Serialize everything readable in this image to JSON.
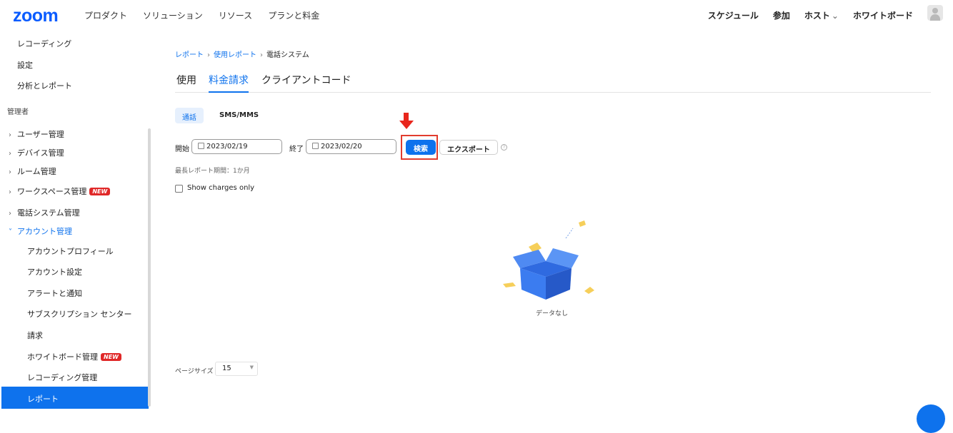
{
  "app": {
    "logo": "zoom"
  },
  "topnav": {
    "left": [
      "プロダクト",
      "ソリューション",
      "リソース",
      "プランと料金"
    ],
    "right": [
      "スケジュール",
      "参加",
      "ホスト",
      "ホワイトボード"
    ],
    "host_chevron": "⌄"
  },
  "sidebar": {
    "top_items": [
      "レコーディング",
      "設定",
      "分析とレポート"
    ],
    "admin_heading": "管理者",
    "admin_items": [
      "ユーザー管理",
      "デバイス管理",
      "ルーム管理",
      "ワークスペース管理",
      "電話システム管理",
      "アカウント管理"
    ],
    "new_badge": "NEW",
    "account_sub": [
      "アカウントプロフィール",
      "アカウント設定",
      "アラートと通知",
      "サブスクリプション センター",
      "請求",
      "ホワイトボード管理",
      "レコーディング管理",
      "レポート"
    ],
    "chevron_right": "›",
    "chevron_down": "˅"
  },
  "breadcrumb": {
    "items": [
      "レポート",
      "使用レポート",
      "電話システム"
    ],
    "sep": "›"
  },
  "tabs": [
    "使用",
    "料金請求",
    "クライアントコード"
  ],
  "subtabs": [
    "通話",
    "SMS/MMS"
  ],
  "filters": {
    "start_label": "開始",
    "start_date": "2023/02/19",
    "end_label": "終了",
    "end_date": "2023/02/20",
    "search_button": "検索",
    "export_button": "エクスポート",
    "help": "?",
    "max_period": "最長レポート期間：1か月",
    "show_charges_only": "Show charges only"
  },
  "empty": {
    "text": "データなし"
  },
  "pagination": {
    "label": "ページサイズ",
    "value": "15",
    "caret": "▼"
  },
  "colors": {
    "brand": "#0b5cff",
    "accent": "#0e72ed",
    "highlight": "#e23c2e",
    "badge": "#e02828"
  }
}
